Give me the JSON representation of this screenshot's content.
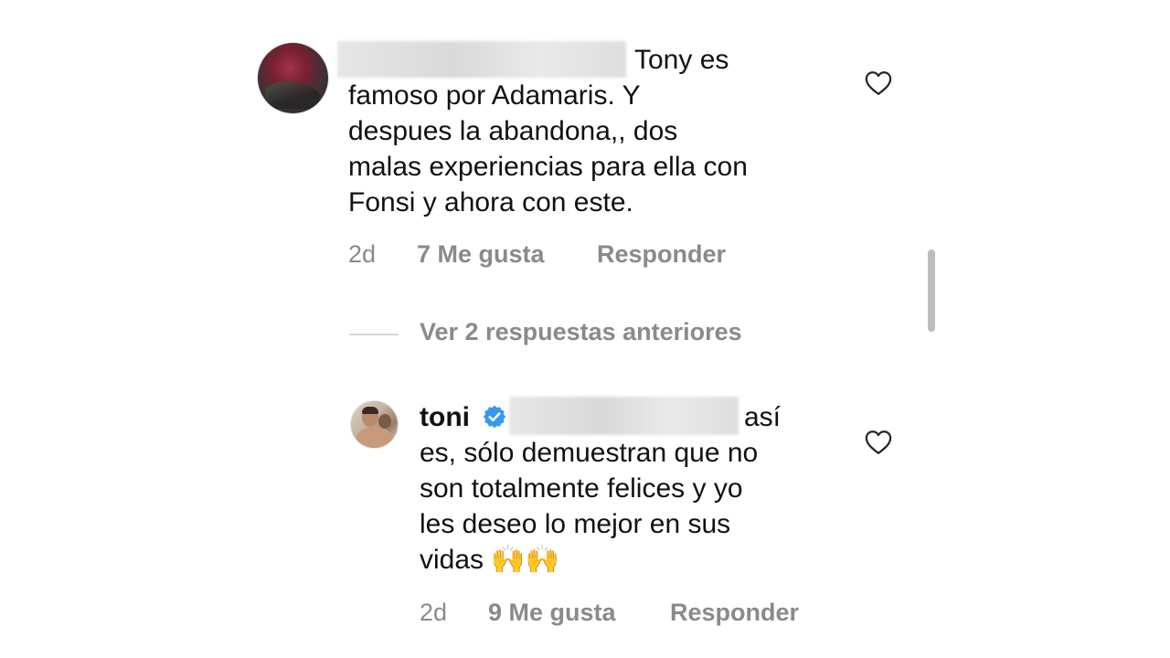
{
  "comment": {
    "line1_suffix": "Tony es",
    "line2": "famoso por Adamaris. Y",
    "line3": "despues la abandona,, dos",
    "line4": "malas experiencias para ella con",
    "line5": "Fonsi y ahora  con este.",
    "time": "2d",
    "likes": "7 Me gusta",
    "reply_label": "Responder"
  },
  "replies_toggle": {
    "label": "Ver 2 respuestas anteriores"
  },
  "reply": {
    "username": "toni",
    "line1_suffix": "así",
    "line2": "es, sólo demuestran que no",
    "line3": "son totalmente felices y yo",
    "line4": "les deseo lo mejor en sus",
    "line5_text": "vidas",
    "line5_emoji": "🙌🙌",
    "time": "2d",
    "likes": "9 Me gusta",
    "reply_label": "Responder"
  },
  "colors": {
    "text": "#111111",
    "muted": "#8a8a8a",
    "verified": "#3897f0"
  },
  "icons": {
    "like": "heart-icon",
    "verified": "verified-badge-icon"
  }
}
